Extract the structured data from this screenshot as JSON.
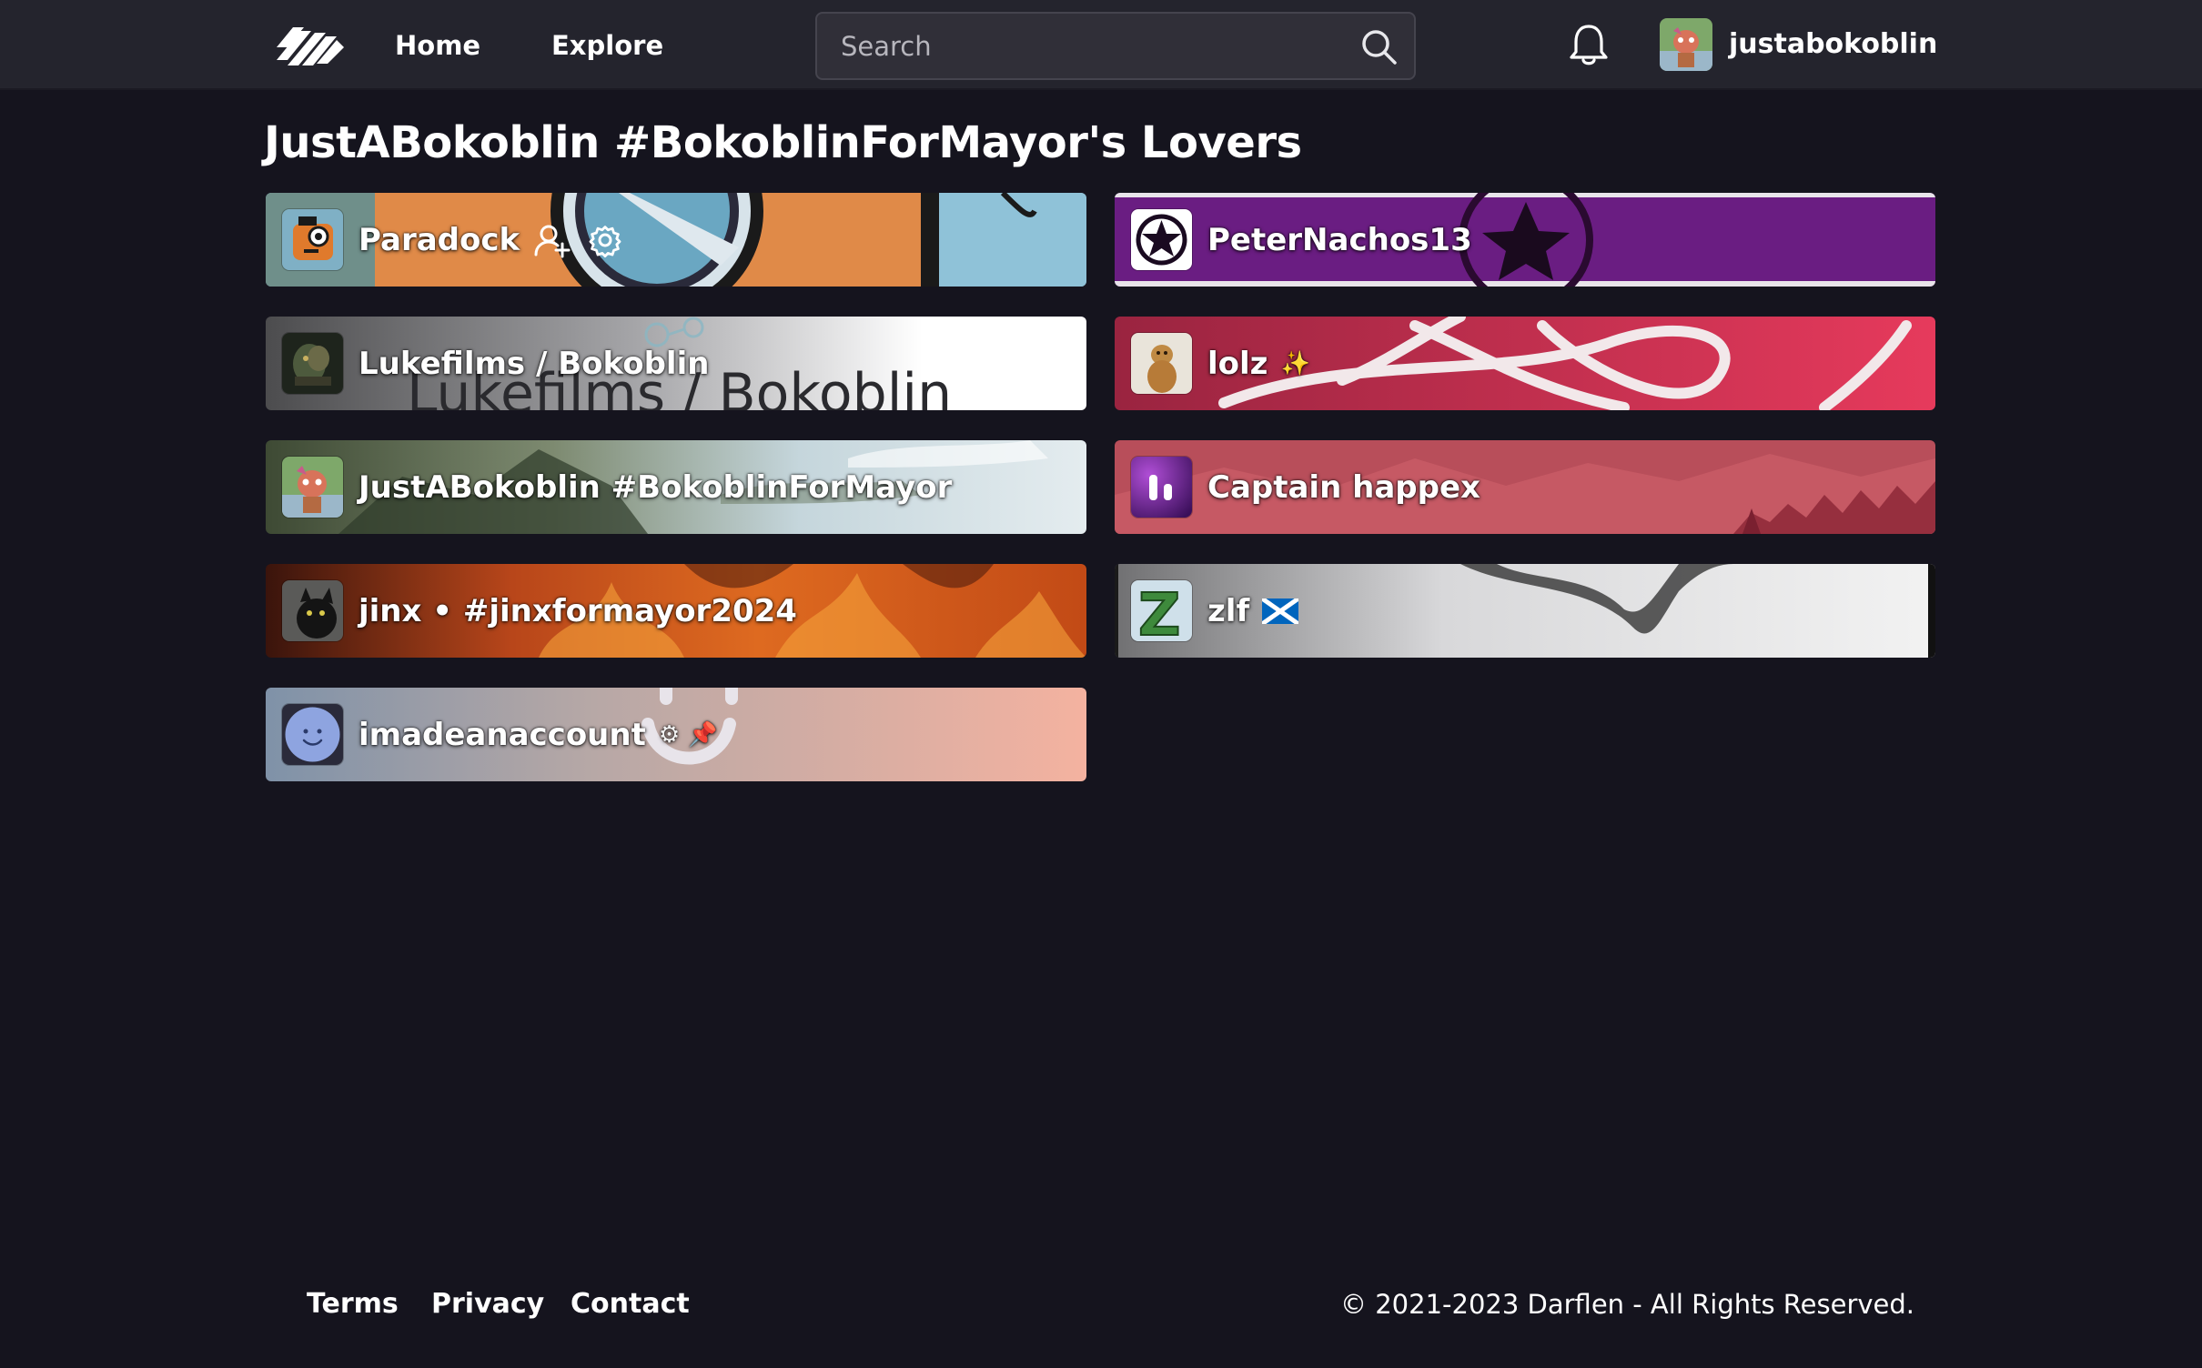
{
  "nav": {
    "home_label": "Home",
    "explore_label": "Explore",
    "search_placeholder": "Search",
    "logo_icon": "darflen-logo-icon",
    "notifications_icon": "bell-icon",
    "username": "justabokoblin"
  },
  "page": {
    "title": "JustABokoblin #BokoblinForMayor's Lovers"
  },
  "users": [
    {
      "name": "Paradock",
      "extras": [
        "add-user-icon",
        "gear-icon"
      ],
      "banner_colors": [
        "#e08a48",
        "#86b9cf"
      ]
    },
    {
      "name": "PeterNachos13",
      "extras": [],
      "banner_colors": [
        "#6a1d82",
        "#8b2a9c"
      ]
    },
    {
      "name": "Lukefilms / Bokoblin",
      "extras": [],
      "banner_colors": [
        "#2a2a2a",
        "#ffffff"
      ]
    },
    {
      "name": "lolz",
      "emoji": "✨",
      "banner_colors": [
        "#a8294a",
        "#e03a5c"
      ]
    },
    {
      "name": "JustABokoblin #BokoblinForMayor",
      "extras": [],
      "banner_colors": [
        "#4a5a3a",
        "#dbe6ea"
      ]
    },
    {
      "name": "Captain happex",
      "extras": [],
      "banner_colors": [
        "#b24a58",
        "#c8555f"
      ]
    },
    {
      "name": "jinx • #jinxformayor2024",
      "extras": [],
      "banner_colors": [
        "#4a1a10",
        "#d8561a"
      ]
    },
    {
      "name": "zlf",
      "emoji": "🏴",
      "banner_colors": [
        "#d9d9da",
        "#888888"
      ]
    },
    {
      "name": "imadeanaccount",
      "emoji": "⚙ 📌",
      "banner_colors": [
        "#8a9db5",
        "#f3b4a2"
      ]
    }
  ],
  "footer": {
    "terms": "Terms",
    "privacy": "Privacy",
    "contact": "Contact",
    "copyright": "© 2021-2023 Darflen - All Rights Reserved."
  }
}
